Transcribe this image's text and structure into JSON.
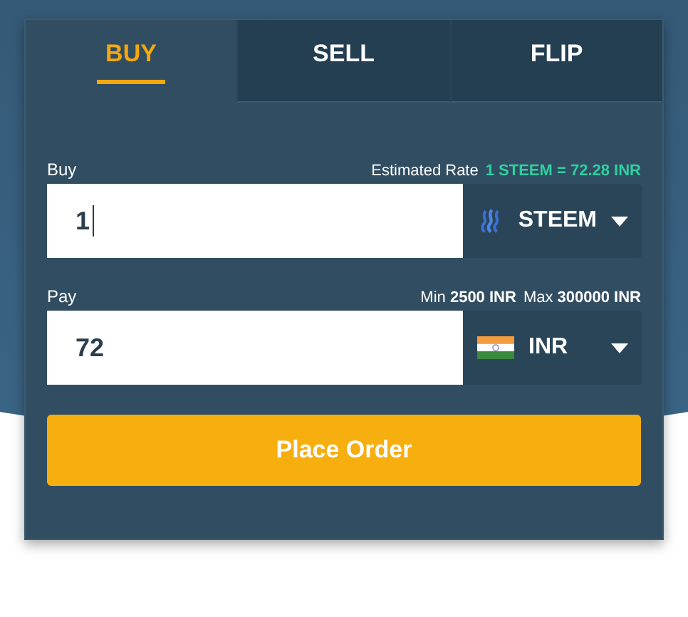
{
  "tabs": [
    {
      "label": "BUY",
      "selected": true
    },
    {
      "label": "SELL",
      "selected": false
    },
    {
      "label": "FLIP",
      "selected": false
    }
  ],
  "fields": [
    {
      "label": "Buy",
      "value": "1",
      "focused": true,
      "notes": [
        {
          "kind": "label",
          "text": "Estimated Rate"
        },
        {
          "kind": "rate",
          "text": "1 STEEM = 72.28  INR"
        }
      ],
      "currency": "STEEM"
    },
    {
      "label": "Pay",
      "value": "72",
      "focused": false,
      "notes": [
        {
          "kind": "limit",
          "text": "Min **2500 INR**"
        },
        {
          "kind": "limit",
          "text": "Max **300000 INR**"
        }
      ],
      "currency": "INR"
    }
  ],
  "button": "Place Order"
}
